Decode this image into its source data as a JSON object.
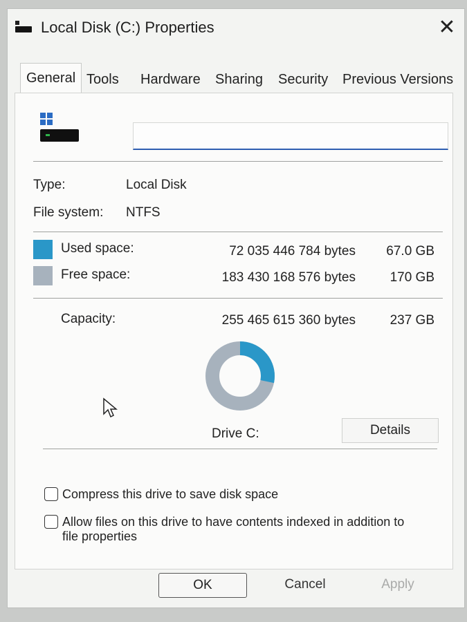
{
  "window": {
    "title": "Local Disk (C:) Properties",
    "close_glyph": "✕"
  },
  "tabs": [
    {
      "label": "General",
      "active": true
    },
    {
      "label": "Tools"
    },
    {
      "label": "Hardware"
    },
    {
      "label": "Sharing"
    },
    {
      "label": "Security"
    },
    {
      "label": "Previous Versions"
    }
  ],
  "general": {
    "name_value": "",
    "type_label": "Type:",
    "type_value": "Local Disk",
    "fs_label": "File system:",
    "fs_value": "NTFS",
    "used": {
      "label": "Used space:",
      "bytes": "72 035 446 784 bytes",
      "size": "67.0 GB",
      "color": "#2a97c8"
    },
    "free": {
      "label": "Free space:",
      "bytes": "183 430 168 576 bytes",
      "size": "170 GB",
      "color": "#a7b2bd"
    },
    "capacity": {
      "label": "Capacity:",
      "bytes": "255 465 615 360 bytes",
      "size": "237 GB"
    },
    "used_fraction": 0.282,
    "drive_label": "Drive C:",
    "details_button": "Details",
    "compress_label": "Compress this drive to save disk space",
    "compress_checked": false,
    "index_label_line1": "Allow files on this drive to have contents indexed in addition to",
    "index_label_line2": "file properties",
    "index_checked": false
  },
  "buttons": {
    "ok": "OK",
    "cancel": "Cancel",
    "apply": "Apply"
  }
}
